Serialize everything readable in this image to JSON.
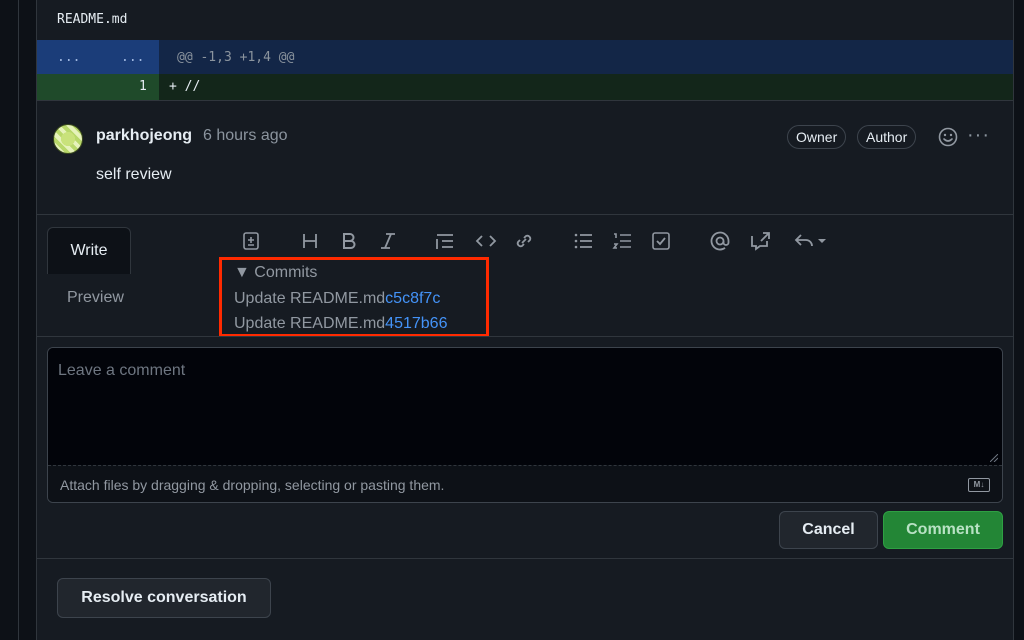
{
  "file": {
    "name": "README.md",
    "hunk_old_gutter": "...",
    "hunk_new_gutter": "...",
    "hunk_header": "@@ -1,3 +1,4 @@",
    "added_line_number": "1",
    "added_line_text": "+ //"
  },
  "comment": {
    "author": "parkhojeong",
    "time": "6 hours ago",
    "badges": [
      "Owner",
      "Author"
    ],
    "more": "···",
    "body": "self review"
  },
  "editor": {
    "tabs": {
      "write": "Write",
      "preview": "Preview"
    },
    "toolbar_icons": [
      "diff-icon",
      "heading-icon",
      "bold-icon",
      "italic-icon",
      "quote-icon",
      "code-icon",
      "link-icon",
      "unordered-list-icon",
      "ordered-list-icon",
      "tasklist-icon",
      "mention-icon",
      "reference-icon",
      "reply-icon"
    ],
    "commits": {
      "title": "Commits",
      "items": [
        {
          "message": "Update README.md",
          "hash": "c5c8f7c"
        },
        {
          "message": "Update README.md",
          "hash": "4517b66"
        }
      ]
    },
    "placeholder": "Leave a comment",
    "attach_text": "Attach files by dragging & dropping, selecting or pasting them.",
    "markdown_badge": "M↓",
    "cancel_label": "Cancel",
    "comment_label": "Comment"
  },
  "resolve_label": "Resolve conversation",
  "colors": {
    "background": "#0d1117",
    "panel": "#161b22",
    "link": "#4493f8",
    "primary_button": "#238636",
    "highlight_box": "#ff2a00"
  }
}
